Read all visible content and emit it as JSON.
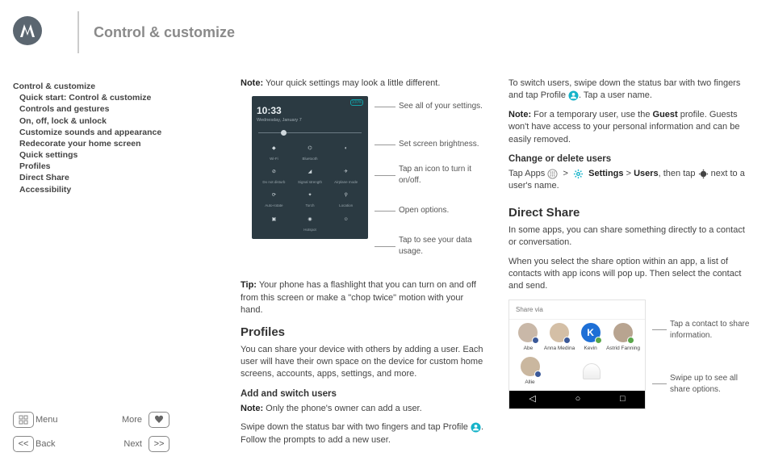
{
  "header": {
    "title": "Control & customize"
  },
  "toc": {
    "root": "Control & customize",
    "items": [
      "Quick start: Control & customize",
      "Controls and gestures",
      "On, off, lock & unlock",
      "Customize sounds and appearance",
      "Redecorate your home screen",
      "Quick settings",
      "Profiles",
      "Direct Share",
      "Accessibility"
    ]
  },
  "nav": {
    "menu": "Menu",
    "more": "More",
    "back": "Back",
    "next": "Next"
  },
  "col1": {
    "note_label": "Note:",
    "note_text": " Your quick settings may look a little different.",
    "qs": {
      "battery": "100%",
      "time": "10:33",
      "date": "Wednesday, January 7",
      "tiles": [
        "Wi-Fi",
        "Bluetooth",
        "",
        "Do not disturb",
        "Signal strength",
        "Airplane mode",
        "Auto-rotate",
        "Torch",
        "Location",
        "",
        "Hotspot",
        ""
      ]
    },
    "callouts": [
      "See all of your settings.",
      "Set screen brightness.",
      "Tap an icon to turn it on/off.",
      "Open options.",
      "Tap to see your data usage."
    ],
    "tip_label": "Tip:",
    "tip_text": "  Your phone has a flashlight that you can turn on and off from this screen or make a \"chop twice\" motion with your hand.",
    "profiles_h": "Profiles",
    "profiles_text": "You can share your device with others by adding a user. Each user will have their own space on the device for custom home screens, accounts, apps, settings, and more.",
    "add_h": "Add and switch users",
    "add_note_label": "Note:",
    "add_note_text": " Only the phone's owner can add a user.",
    "add_swipe_a": "Swipe down the status bar with two fingers and tap Profile ",
    "add_swipe_b": ". Follow the prompts to add a new user."
  },
  "col2": {
    "switch_a": "To switch users, swipe down the status bar with two fingers and tap Profile ",
    "switch_b": ". Tap a user name.",
    "guest_label": "Note:",
    "guest_a": " For a temporary user, use the ",
    "guest_b": "Guest",
    "guest_c": " profile. Guests won't have access to your personal information and can be easily removed.",
    "change_h": "Change or delete users",
    "change_a": "Tap Apps ",
    "change_b": "Settings",
    "change_c": "Users",
    "change_d": ", then tap ",
    "change_e": " next to a user's name.",
    "ds_h": "Direct Share",
    "ds_p1": "In some apps, you can share something directly to a contact or conversation.",
    "ds_p2": "When you select the share option within an app, a list of contacts with app icons will pop up. Then select the contact and send.",
    "share": {
      "title": "Share via",
      "names": [
        "Abe",
        "Anna Medina",
        "Kevin",
        "Astrid Fanning",
        "Allie"
      ]
    },
    "share_callouts": [
      "Tap a contact to share information.",
      "Swipe up to see all share options."
    ]
  }
}
